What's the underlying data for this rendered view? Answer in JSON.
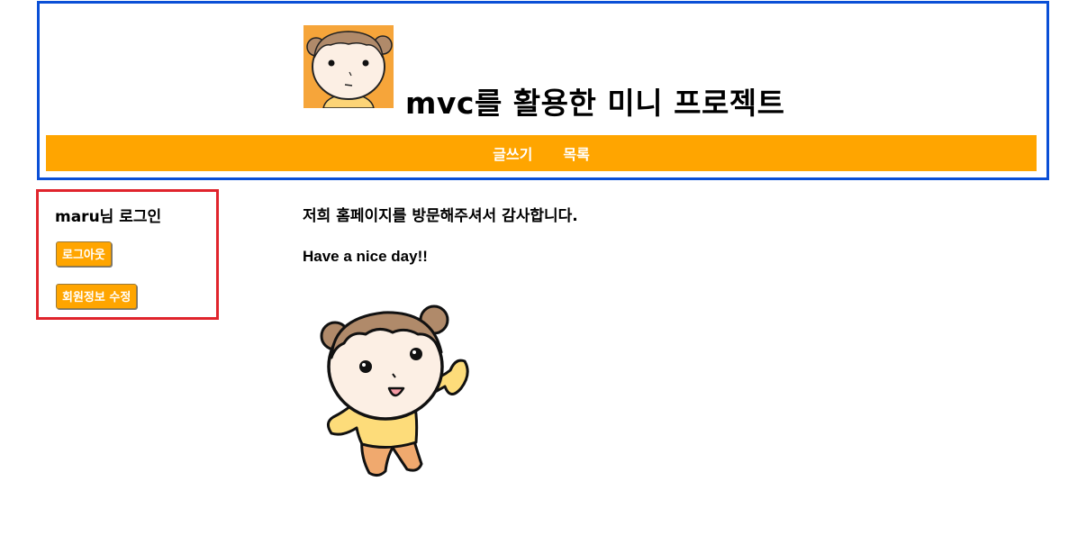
{
  "header": {
    "title": "mvc를 활용한 미니 프로젝트",
    "logo_icon": "girl-avatar-icon"
  },
  "nav": {
    "items": [
      {
        "label": "글쓰기"
      },
      {
        "label": "목록"
      }
    ]
  },
  "login": {
    "greeting": "maru님 로그인",
    "logout_label": "로그아웃",
    "edit_profile_label": "회원정보 수정"
  },
  "main": {
    "welcome_text": "저희 홈페이지를 방문해주셔서 감사합니다.",
    "motto_text": "Have a nice day!!",
    "illustration_icon": "waving-girl-icon"
  },
  "colors": {
    "header_border": "#0a4fd6",
    "nav_background": "#ffa500",
    "login_border": "#e0242c",
    "logo_background": "#f6a53a"
  }
}
